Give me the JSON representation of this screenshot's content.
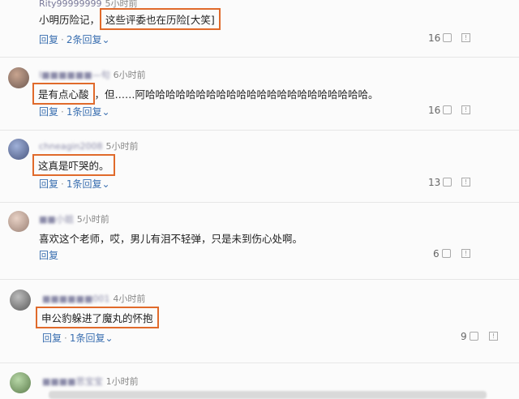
{
  "comments": [
    {
      "user": "Rity99999999",
      "time": "5小时前",
      "prefix": "小明历险记，",
      "highlight": "这些评委也在历险[大笑]",
      "suffix": "",
      "reply": "回复",
      "replies": "2条回复",
      "likes": "16"
    },
    {
      "user": "I■■■■■■—句",
      "time": "6小时前",
      "prefix": "",
      "highlight": "是有点心酸",
      "suffix": "，但……阿哈哈哈哈哈哈哈哈哈哈哈哈哈哈哈哈哈哈哈哈哈哈。",
      "reply": "回复",
      "replies": "1条回复",
      "likes": "16"
    },
    {
      "user": "chneagin2008",
      "time": "5小时前",
      "prefix": "",
      "highlight": "这真是吓哭的。",
      "suffix": "",
      "reply": "回复",
      "replies": "1条回复",
      "likes": "13"
    },
    {
      "user": "■■小姐",
      "time": "5小时前",
      "prefix": "喜欢这个老师，哎，男儿有泪不轻弹，只是未到伤心处啊。",
      "highlight": "",
      "suffix": "",
      "reply": "回复",
      "replies": "",
      "likes": "6"
    },
    {
      "user": "■■■■■■001",
      "time": "4小时前",
      "prefix": "",
      "highlight": "申公豹躲进了魔丸的怀抱",
      "suffix": "",
      "reply": "回复",
      "replies": "1条回复",
      "likes": "9"
    },
    {
      "user": "■■■■思宝宝",
      "time": "1小时前",
      "prefix": "",
      "highlight": "",
      "suffix": "",
      "reply": "",
      "replies": "",
      "likes": ""
    }
  ],
  "icons": {
    "like": "thumb-up-icon",
    "report": "report-icon",
    "expand": "chevron-down-icon"
  },
  "colors": {
    "link": "#3a6fb0",
    "highlight_border": "#e06a2b"
  }
}
